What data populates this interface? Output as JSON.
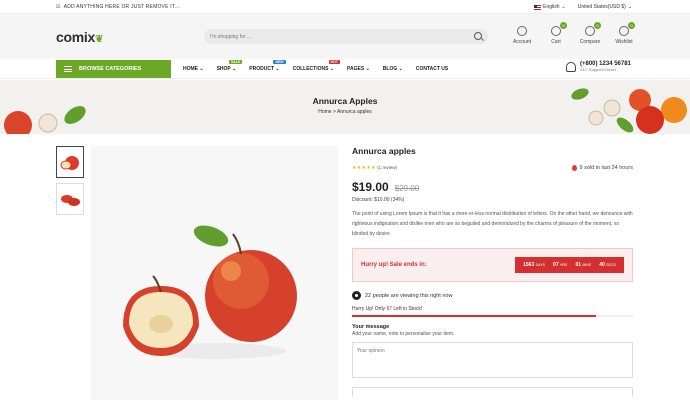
{
  "topbar": {
    "notice": "ADD ANYTHING HERE OR JUST REMOVE IT...",
    "language": "English",
    "currency": "United States(USD $)"
  },
  "header": {
    "logo": "comix",
    "search_placeholder": "I'm shopping for ...",
    "actions": [
      {
        "label": "Account",
        "icon": "user-icon"
      },
      {
        "label": "Cart",
        "icon": "cart-icon",
        "badge": "0"
      },
      {
        "label": "Compare",
        "icon": "compare-icon",
        "badge": "0"
      },
      {
        "label": "Wishlist",
        "icon": "heart-icon",
        "badge": "0"
      }
    ]
  },
  "nav": {
    "browse_label": "BROWSE CATEGORIES",
    "items": [
      {
        "label": "HOME",
        "tag": ""
      },
      {
        "label": "SHOP",
        "tag": "SALE",
        "tag_color": "#6aa826"
      },
      {
        "label": "PRODUCT",
        "tag": "NEW",
        "tag_color": "#2a7ed8"
      },
      {
        "label": "COLLECTIONS",
        "tag": "HOT",
        "tag_color": "#d3302f"
      },
      {
        "label": "PAGES",
        "tag": ""
      },
      {
        "label": "BLOG",
        "tag": ""
      },
      {
        "label": "CONTACT US",
        "tag": ""
      }
    ],
    "support_number": "(+800) 1234 56781",
    "support_label": "24/7 Support Center"
  },
  "banner": {
    "title": "Annurca Apples",
    "breadcrumb_home": "Home",
    "breadcrumb_sep": ">",
    "breadcrumb_current": "Annurca apples"
  },
  "product": {
    "title": "Annurca apples",
    "rating_stars": "★★★★★",
    "reviews": "(1 review)",
    "sold": "9 sold in last 24 hours",
    "price": "$19.00",
    "old_price": "$29.00",
    "discount": "Discount: $10.00 (34%)",
    "description": "The point of using Lorem Ipsum is that it has a more-or-less normal distribution of letters. On the other hand, we denounce with righteous indignation and dislike men who are so beguiled and demoralized by the charms of pleasure of the moment, so blinded by desire",
    "sale_label": "Hurry up! Sale ends in:",
    "timer": {
      "days": "1563",
      "days_label": "DAYS",
      "hrs": "07",
      "hrs_label": "HRS",
      "mins": "01",
      "mins_label": "MINS",
      "secs": "40",
      "secs_label": "SECS"
    },
    "viewing": "22 people are viewing this right now",
    "hurry_prefix": "Hurry Up! Only",
    "stock_left": "87",
    "hurry_suffix": "Left in Stock!",
    "stock_progress": 0.87,
    "message_title": "Your message",
    "message_sub": "Add your name, note to personalise your item.",
    "message_placeholder": "Your opinion"
  },
  "colors": {
    "brand": "#6aa826",
    "sale": "#d3302f",
    "star": "#f4b400"
  }
}
